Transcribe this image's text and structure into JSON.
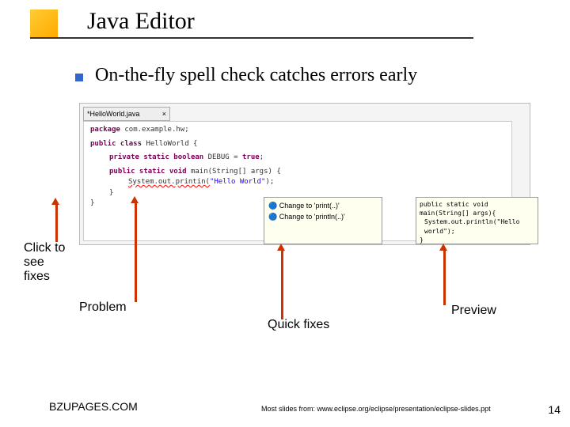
{
  "title": "Java Editor",
  "body": "On-the-fly spell check catches errors early",
  "tabLabel": "*HelloWorld.java",
  "code": {
    "l1a": "package",
    "l1b": " com.example.hw;",
    "l2a": "public class",
    "l2b": " HelloWorld {",
    "l3a": "private static boolean",
    "l3b": " DEBUG = ",
    "l3c": "true",
    "l3d": ";",
    "l4a": "public static void",
    "l4b": " main(String[] args) {",
    "l5a": "System.out.printin(",
    "l5b": "\"Hello World\"",
    "l5c": ");",
    "l6": "}",
    "l7": "}"
  },
  "quickfix": {
    "item1": "Change to 'print(..)'",
    "item2": "Change to 'println(..)'"
  },
  "preview": {
    "l1": "public static void main(String[] args){",
    "l2": "System.out.println(\"Hello world\");",
    "l3": "}"
  },
  "annotations": {
    "click": "Click to see fixes",
    "problem": "Problem",
    "quick": "Quick fixes",
    "preview": "Preview"
  },
  "footer": {
    "left": "BZUPAGES.COM",
    "center": "Most slides from: www.eclipse.org/eclipse/presentation/eclipse-slides.ppt",
    "page": "14"
  }
}
